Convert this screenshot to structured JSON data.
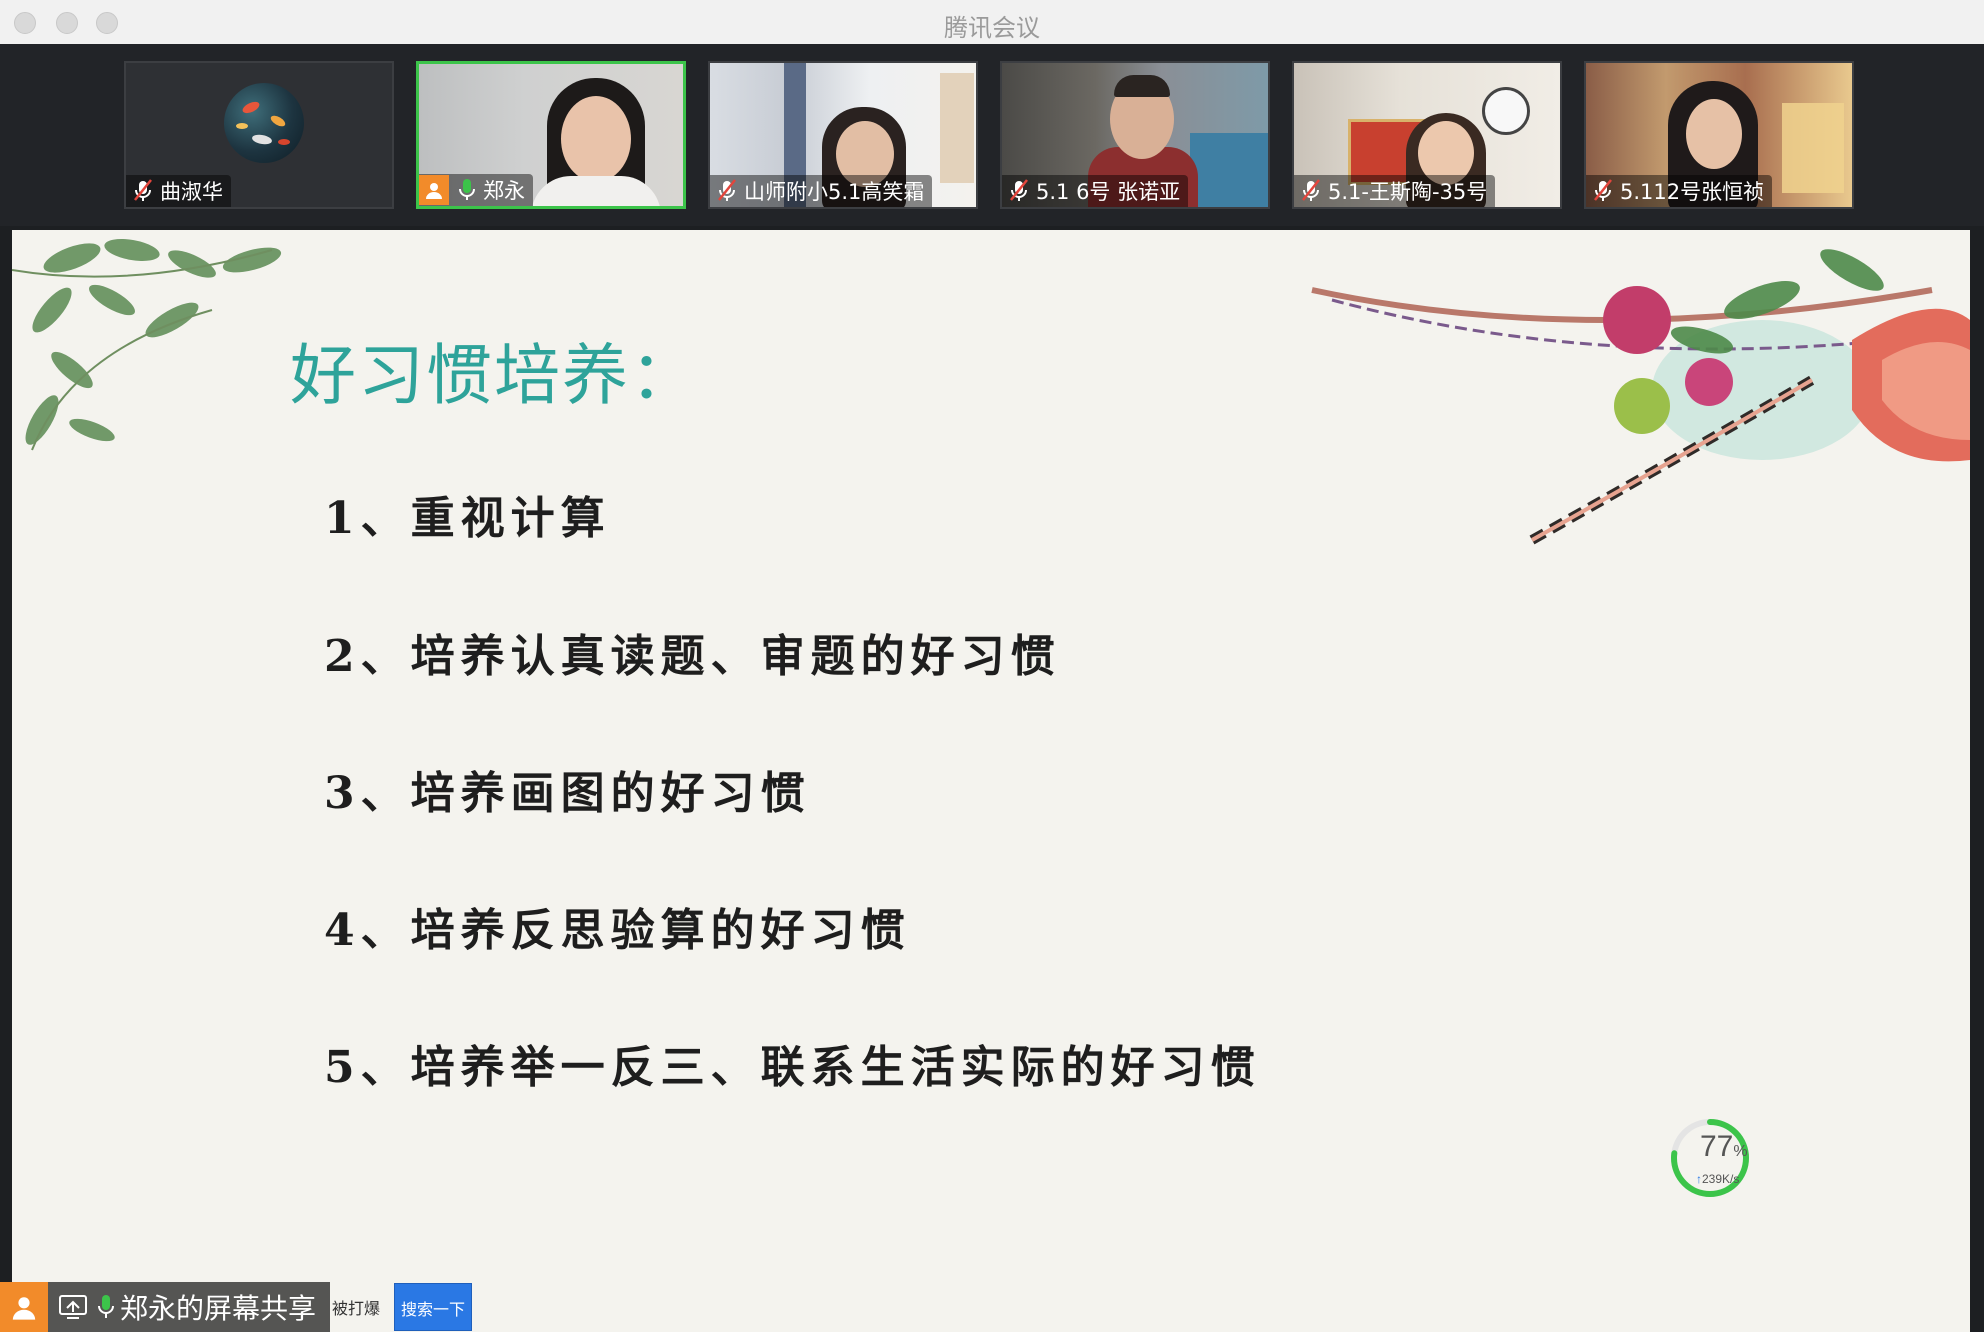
{
  "window": {
    "title": "腾讯会议"
  },
  "participants": [
    {
      "name": "曲淑华",
      "mic": "muted"
    },
    {
      "name": "郑永",
      "mic": "on",
      "active": true
    },
    {
      "name": "山师附小5.1高笑霜",
      "mic": "muted"
    },
    {
      "name": "5.1  6号  张诺亚",
      "mic": "muted"
    },
    {
      "name": "5.1-王斯陶-35号",
      "mic": "muted"
    },
    {
      "name": "5.112号张恒祯",
      "mic": "muted"
    }
  ],
  "slide": {
    "title": "好习惯培养：",
    "items": [
      "1、重视计算",
      "2、培养认真读题、审题的好习惯",
      "3、培养画图的好习惯",
      "4、培养反思验算的好习惯",
      "5、培养举一反三、联系生活实际的好习惯"
    ]
  },
  "network_widget": {
    "percent": 77,
    "percent_unit": "%",
    "upload_speed": "239K/s"
  },
  "share_banner": {
    "label": "郑永的屏幕共享"
  },
  "background_ui": {
    "partial_text": "被打爆",
    "search_button": "搜索一下"
  },
  "colors": {
    "title": "#2ea39a",
    "active_border": "#3cc44a",
    "share_avatar": "#f28b2a",
    "search_button": "#2a78e4"
  }
}
